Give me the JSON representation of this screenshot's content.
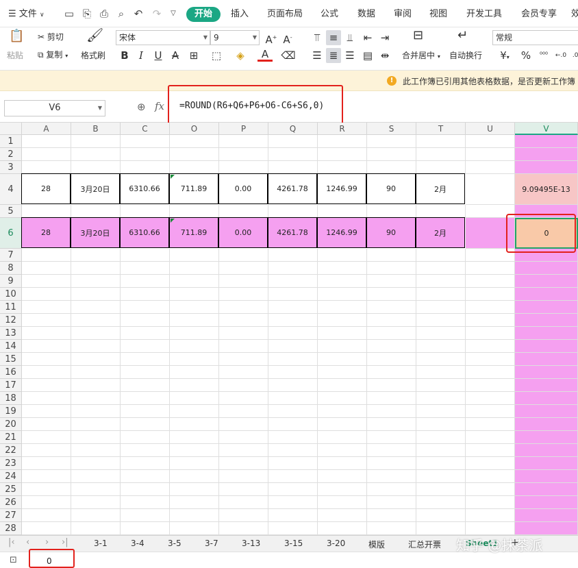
{
  "menu": {
    "file": "文件",
    "items": [
      "开始",
      "插入",
      "页面布局",
      "公式",
      "数据",
      "审阅",
      "视图",
      "开发工具",
      "会员专享",
      "效"
    ]
  },
  "ribbon": {
    "paste": "粘贴",
    "cut": "剪切",
    "copy": "复制",
    "format_painter": "格式刷",
    "font_name": "宋体",
    "font_size": "9",
    "merge_center": "合并居中",
    "wrap_text": "自动换行",
    "number_format": "常规",
    "percent_symbol": "%",
    "currency_symbol": "¥",
    "bold": "B",
    "italic": "I",
    "underline": "U"
  },
  "notice": {
    "text": "此工作簿已引用其他表格数据，是否更新工作簿"
  },
  "formula_bar": {
    "name_box": "V6",
    "fx": "fx",
    "formula": "=ROUND(R6+Q6+P6+O6-C6+S6,0)"
  },
  "grid": {
    "columns": [
      "A",
      "B",
      "C",
      "O",
      "P",
      "Q",
      "R",
      "S",
      "T",
      "U",
      "V"
    ],
    "rows": [
      "1",
      "2",
      "3",
      "4",
      "5",
      "6",
      "7",
      "8",
      "9",
      "10",
      "11",
      "12",
      "13",
      "14",
      "15",
      "16",
      "17",
      "18",
      "19",
      "20",
      "21",
      "22",
      "23",
      "24",
      "25",
      "26",
      "27",
      "28"
    ],
    "row4": [
      "28",
      "3月20日",
      "6310.66",
      "711.89",
      "0.00",
      "4261.78",
      "1246.99",
      "90",
      "2月",
      "",
      "9.09495E-13"
    ],
    "row6": [
      "28",
      "3月20日",
      "6310.66",
      "711.89",
      "0.00",
      "4261.78",
      "1246.99",
      "90",
      "2月",
      "",
      "0"
    ]
  },
  "sheet_tabs": [
    "3-1",
    "3-4",
    "3-5",
    "3-7",
    "3-13",
    "3-15",
    "3-20",
    "模版",
    "汇总开票",
    "Sheet1"
  ],
  "status": {
    "value": "0"
  },
  "watermark": "知乎 @抹茶派",
  "colors": {
    "accent": "#1ba784",
    "highlight_pink": "#f5a0f0",
    "active_cell": "#f9c9a8",
    "red_annotation": "#e2211c",
    "notice_bg": "#fdf3d9"
  }
}
